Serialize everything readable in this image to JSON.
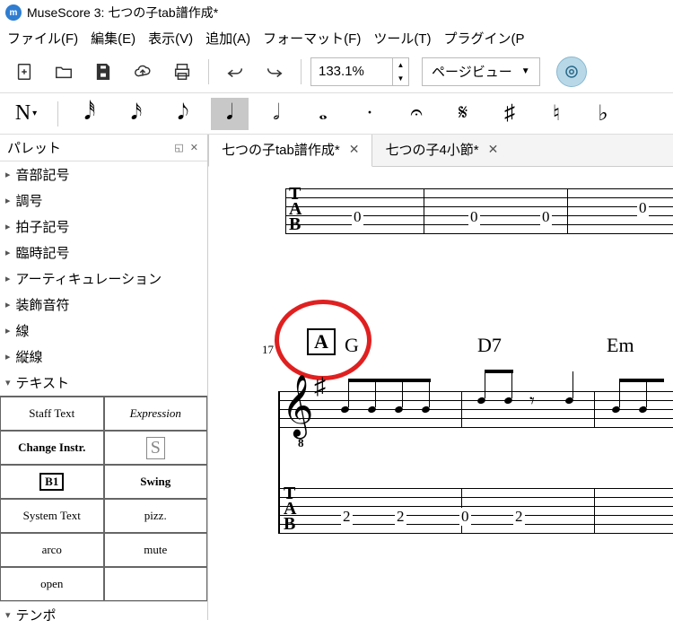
{
  "window": {
    "title": "MuseScore 3: 七つの子tab譜作成*"
  },
  "menus": [
    "ファイル(F)",
    "編集(E)",
    "表示(V)",
    "追加(A)",
    "フォーマット(F)",
    "ツール(T)",
    "プラグイン(P"
  ],
  "toolbar": {
    "zoom": "133.1%",
    "view_mode": "ページビュー"
  },
  "note_toolbar": {
    "first": "N",
    "glyphs": [
      "𝅘𝅥𝅰",
      "𝅘𝅥𝅯",
      "𝅘𝅥𝅮",
      "𝅘𝅥",
      "𝅗𝅥",
      "𝅝",
      "·",
      "𝄐",
      "𝄋",
      "♯",
      "♮",
      "♭"
    ]
  },
  "palette": {
    "title": "パレット",
    "items": [
      "音部記号",
      "調号",
      "拍子記号",
      "臨時記号",
      "アーティキュレーション",
      "装飾音符",
      "線",
      "縦線",
      "テキスト"
    ],
    "bottom": "テンポ",
    "text_cells": [
      [
        "Staff Text",
        "Expression"
      ],
      [
        "Change Instr.",
        "S"
      ],
      [
        "B1",
        "Swing"
      ],
      [
        "System Text",
        "pizz."
      ],
      [
        "arco",
        "mute"
      ],
      [
        "open",
        ""
      ]
    ]
  },
  "tabs": [
    {
      "label": "七つの子tab譜作成*",
      "active": true
    },
    {
      "label": "七つの子4小節*",
      "active": false
    }
  ],
  "score": {
    "measure_no": "17",
    "rehearsal": "A",
    "chords": [
      "G",
      "D7",
      "Em"
    ],
    "tab1_frets": [
      "0",
      "0",
      "0",
      "0"
    ],
    "tab2_frets": [
      "2",
      "2",
      "0",
      "2"
    ]
  }
}
